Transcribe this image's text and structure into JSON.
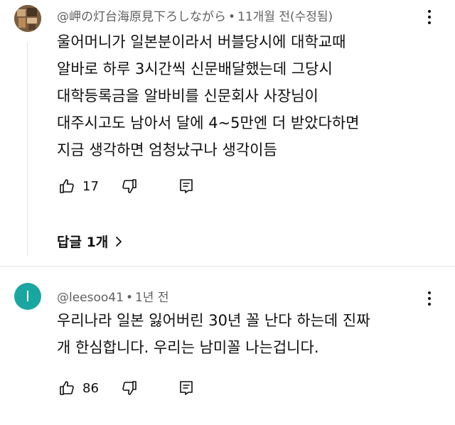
{
  "comments": [
    {
      "author": "@岬の灯台海原見下ろしながら",
      "time": "11개월 전(수정됨)",
      "text_lines": [
        "울어머니가 일본분이라서 버블당시에 대학교때",
        "알바로 하루 3시간씩 신문배달했는데 그당시",
        "대학등록금을 알바비를 신문회사 사장님이",
        "대주시고도 남아서 달에 4~5만엔 더 받았다하면",
        "지금 생각하면 엄청났구나 생각이듬"
      ],
      "likes": "17",
      "replies_label": "답글 1개",
      "avatar_icon": "photo-avatar-icon"
    },
    {
      "author": "@leesoo41",
      "time": "1년 전",
      "avatar_letter": "I",
      "avatar_color": "#1aa6a0",
      "text_lines": [
        "우리나라 일본 잃어버린 30년 꼴 난다 하는데 진짜",
        "개 한심합니다. 우리는 남미꼴 나는겁니다."
      ],
      "likes": "86"
    }
  ],
  "separator": "•",
  "icons": {
    "like": "thumbs-up-icon",
    "dislike": "thumbs-down-icon",
    "reply": "reply-comment-icon",
    "more": "more-vertical-icon",
    "chevron": "chevron-right-icon"
  }
}
